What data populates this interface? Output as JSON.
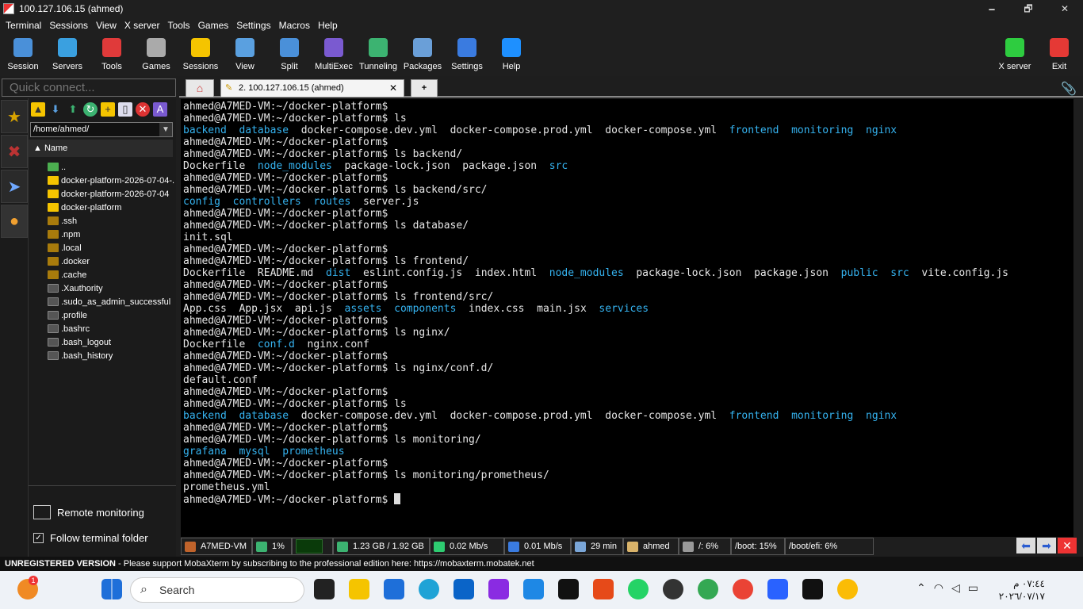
{
  "window": {
    "title": "100.127.106.15 (ahmed)",
    "controls": [
      "🗕",
      "🗗",
      "✕"
    ]
  },
  "menu": [
    "Terminal",
    "Sessions",
    "View",
    "X server",
    "Tools",
    "Games",
    "Settings",
    "Macros",
    "Help"
  ],
  "toolbar": {
    "buttons": [
      {
        "label": "Session",
        "icon": "session-icon",
        "color": "#4a90d9"
      },
      {
        "label": "Servers",
        "icon": "servers-icon",
        "color": "#3aa0e0"
      },
      {
        "label": "Tools",
        "icon": "tools-icon",
        "color": "#e03a3a"
      },
      {
        "label": "Games",
        "icon": "games-icon",
        "color": "#aaaaaa"
      },
      {
        "label": "Sessions",
        "icon": "star-icon",
        "color": "#f5c400"
      },
      {
        "label": "View",
        "icon": "view-icon",
        "color": "#5aa0e0"
      },
      {
        "label": "Split",
        "icon": "split-icon",
        "color": "#4a90d9"
      },
      {
        "label": "MultiExec",
        "icon": "multiexec-icon",
        "color": "#7a5ad0"
      },
      {
        "label": "Tunneling",
        "icon": "tunneling-icon",
        "color": "#3cb371"
      },
      {
        "label": "Packages",
        "icon": "packages-icon",
        "color": "#6a9fd8"
      },
      {
        "label": "Settings",
        "icon": "settings-icon",
        "color": "#3a7be0"
      },
      {
        "label": "Help",
        "icon": "help-icon",
        "color": "#1e90ff"
      }
    ],
    "right_buttons": [
      {
        "label": "X server",
        "icon": "xserver-icon",
        "color": "#2ecc40"
      },
      {
        "label": "Exit",
        "icon": "exit-icon",
        "color": "#e53935"
      }
    ]
  },
  "quick_connect": {
    "placeholder": "Quick connect..."
  },
  "tabs": {
    "home": "⌂",
    "session_label": "2. 100.127.106.15 (ahmed)",
    "close": "✕",
    "new": "+"
  },
  "sidebar": {
    "path": "/home/ahmed/",
    "name_column": "Name",
    "files": [
      {
        "name": "..",
        "type": "up"
      },
      {
        "name": "docker-platform-2026-07-04-...",
        "type": "folder"
      },
      {
        "name": "docker-platform-2026-07-04",
        "type": "folder"
      },
      {
        "name": "docker-platform",
        "type": "folder"
      },
      {
        "name": ".ssh",
        "type": "hfolder"
      },
      {
        "name": ".npm",
        "type": "hfolder"
      },
      {
        "name": ".local",
        "type": "hfolder"
      },
      {
        "name": ".docker",
        "type": "hfolder"
      },
      {
        "name": ".cache",
        "type": "hfolder"
      },
      {
        "name": ".Xauthority",
        "type": "file"
      },
      {
        "name": ".sudo_as_admin_successful",
        "type": "file"
      },
      {
        "name": ".profile",
        "type": "file"
      },
      {
        "name": ".bashrc",
        "type": "file"
      },
      {
        "name": ".bash_logout",
        "type": "file"
      },
      {
        "name": ".bash_history",
        "type": "file"
      }
    ],
    "remote_monitoring": "Remote monitoring",
    "follow_terminal": "Follow terminal folder",
    "follow_checked": "✓"
  },
  "terminal": {
    "prompt": "ahmed@A7MED-VM:~/docker-platform$",
    "lines": [
      [
        {
          "t": "ahmed@A7MED-VM:~/docker-platform$",
          "c": "p"
        }
      ],
      [
        {
          "t": "ahmed@A7MED-VM:~/docker-platform$ ls",
          "c": "p"
        }
      ],
      [
        {
          "t": "backend",
          "c": "d"
        },
        {
          "t": "  "
        },
        {
          "t": "database",
          "c": "d"
        },
        {
          "t": "  docker-compose.dev.yml  docker-compose.prod.yml  docker-compose.yml  "
        },
        {
          "t": "frontend",
          "c": "d"
        },
        {
          "t": "  "
        },
        {
          "t": "monitoring",
          "c": "d"
        },
        {
          "t": "  "
        },
        {
          "t": "nginx",
          "c": "d"
        }
      ],
      [
        {
          "t": "ahmed@A7MED-VM:~/docker-platform$"
        }
      ],
      [
        {
          "t": "ahmed@A7MED-VM:~/docker-platform$ ls backend/"
        }
      ],
      [
        {
          "t": "Dockerfile  "
        },
        {
          "t": "node_modules",
          "c": "d"
        },
        {
          "t": "  package-lock.json  package.json  "
        },
        {
          "t": "src",
          "c": "d"
        }
      ],
      [
        {
          "t": "ahmed@A7MED-VM:~/docker-platform$"
        }
      ],
      [
        {
          "t": "ahmed@A7MED-VM:~/docker-platform$ ls backend/src/"
        }
      ],
      [
        {
          "t": "config",
          "c": "d"
        },
        {
          "t": "  "
        },
        {
          "t": "controllers",
          "c": "d"
        },
        {
          "t": "  "
        },
        {
          "t": "routes",
          "c": "d"
        },
        {
          "t": "  server.js"
        }
      ],
      [
        {
          "t": "ahmed@A7MED-VM:~/docker-platform$"
        }
      ],
      [
        {
          "t": "ahmed@A7MED-VM:~/docker-platform$ ls database/"
        }
      ],
      [
        {
          "t": "init.sql"
        }
      ],
      [
        {
          "t": "ahmed@A7MED-VM:~/docker-platform$"
        }
      ],
      [
        {
          "t": "ahmed@A7MED-VM:~/docker-platform$ ls frontend/"
        }
      ],
      [
        {
          "t": "Dockerfile  README.md  "
        },
        {
          "t": "dist",
          "c": "d"
        },
        {
          "t": "  eslint.config.js  index.html  "
        },
        {
          "t": "node_modules",
          "c": "d"
        },
        {
          "t": "  package-lock.json  package.json  "
        },
        {
          "t": "public",
          "c": "d"
        },
        {
          "t": "  "
        },
        {
          "t": "src",
          "c": "d"
        },
        {
          "t": "  vite.config.js"
        }
      ],
      [
        {
          "t": "ahmed@A7MED-VM:~/docker-platform$"
        }
      ],
      [
        {
          "t": "ahmed@A7MED-VM:~/docker-platform$ ls frontend/src/"
        }
      ],
      [
        {
          "t": "App.css  App.jsx  api.js  "
        },
        {
          "t": "assets",
          "c": "d"
        },
        {
          "t": "  "
        },
        {
          "t": "components",
          "c": "d"
        },
        {
          "t": "  index.css  main.jsx  "
        },
        {
          "t": "services",
          "c": "d"
        }
      ],
      [
        {
          "t": "ahmed@A7MED-VM:~/docker-platform$"
        }
      ],
      [
        {
          "t": "ahmed@A7MED-VM:~/docker-platform$ ls nginx/"
        }
      ],
      [
        {
          "t": "Dockerfile  "
        },
        {
          "t": "conf.d",
          "c": "d"
        },
        {
          "t": "  nginx.conf"
        }
      ],
      [
        {
          "t": "ahmed@A7MED-VM:~/docker-platform$"
        }
      ],
      [
        {
          "t": "ahmed@A7MED-VM:~/docker-platform$ ls nginx/conf.d/"
        }
      ],
      [
        {
          "t": "default.conf"
        }
      ],
      [
        {
          "t": "ahmed@A7MED-VM:~/docker-platform$"
        }
      ],
      [
        {
          "t": "ahmed@A7MED-VM:~/docker-platform$ ls"
        }
      ],
      [
        {
          "t": "backend",
          "c": "d"
        },
        {
          "t": "  "
        },
        {
          "t": "database",
          "c": "d"
        },
        {
          "t": "  docker-compose.dev.yml  docker-compose.prod.yml  docker-compose.yml  "
        },
        {
          "t": "frontend",
          "c": "d"
        },
        {
          "t": "  "
        },
        {
          "t": "monitoring",
          "c": "d"
        },
        {
          "t": "  "
        },
        {
          "t": "nginx",
          "c": "d"
        }
      ],
      [
        {
          "t": "ahmed@A7MED-VM:~/docker-platform$"
        }
      ],
      [
        {
          "t": "ahmed@A7MED-VM:~/docker-platform$ ls monitoring/"
        }
      ],
      [
        {
          "t": "grafana",
          "c": "d"
        },
        {
          "t": "  "
        },
        {
          "t": "mysql",
          "c": "d"
        },
        {
          "t": "  "
        },
        {
          "t": "prometheus",
          "c": "d"
        }
      ],
      [
        {
          "t": "ahmed@A7MED-VM:~/docker-platform$"
        }
      ],
      [
        {
          "t": "ahmed@A7MED-VM:~/docker-platform$ ls monitoring/prometheus/"
        }
      ],
      [
        {
          "t": "prometheus.yml"
        }
      ],
      [
        {
          "t": "ahmed@A7MED-VM:~/docker-platform$ "
        },
        {
          "t": "",
          "c": "cursor"
        }
      ]
    ]
  },
  "status": [
    {
      "label": "A7MED-VM",
      "icon": "terminal-icon",
      "color": "#c0632b",
      "w": 90
    },
    {
      "label": "1%",
      "icon": "cpu-icon",
      "color": "#3cb371",
      "w": 50
    },
    {
      "label": "",
      "icon": "cpu-graph",
      "color": "#0a3a0a",
      "w": 52
    },
    {
      "label": "1.23 GB / 1.92 GB",
      "icon": "memory-icon",
      "color": "#3cb371",
      "w": 122
    },
    {
      "label": "0.02 Mb/s",
      "icon": "upload-icon",
      "color": "#2ecc71",
      "w": 94
    },
    {
      "label": "0.01 Mb/s",
      "icon": "download-icon",
      "color": "#3a7be0",
      "w": 84
    },
    {
      "label": "29 min",
      "icon": "clock-icon",
      "color": "#7aa6d8",
      "w": 66
    },
    {
      "label": "ahmed",
      "icon": "user-icon",
      "color": "#d9b36a",
      "w": 70
    },
    {
      "label": "/: 6%",
      "icon": "disk-icon",
      "color": "#999999",
      "w": 66
    },
    {
      "label": "/boot: 15%",
      "w": 68
    },
    {
      "label": "/boot/efi: 6%",
      "w": 112
    }
  ],
  "nav": {
    "back": "⬅",
    "forward": "➡",
    "close": "✕"
  },
  "unregistered": {
    "bold": "UNREGISTERED VERSION",
    "text": "  -  Please support MobaXterm by subscribing to the professional edition here:  ",
    "link": "https://mobaxterm.mobatek.net"
  },
  "taskbar": {
    "search_placeholder": "Search",
    "time": "٠٧:٤٤ م",
    "date": "٢٠٢٦/٠٧/١٧",
    "notification_badge": "1"
  }
}
